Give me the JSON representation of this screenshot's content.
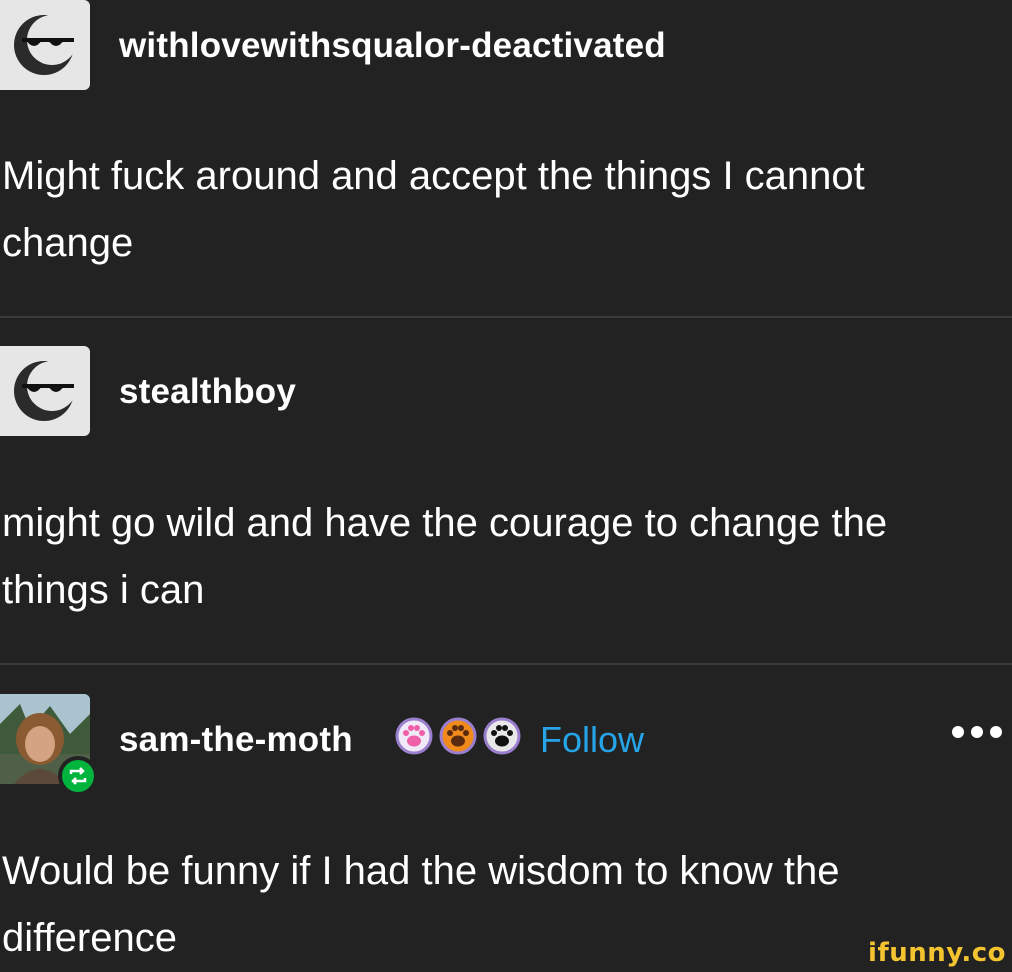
{
  "posts": [
    {
      "username": "withlovewithsqualor-deactivated",
      "avatar_icon": "sunglasses-moon-icon",
      "text_line1": "Might fuck around and accept the things I cannot",
      "text_line2": "change"
    },
    {
      "username": "stealthboy",
      "avatar_icon": "sunglasses-moon-icon",
      "text_line1": "might go wild and have the courage to change the",
      "text_line2": "things i can"
    },
    {
      "username": "sam-the-moth",
      "avatar_icon": "profile-photo",
      "badges": [
        "pink-paw-icon",
        "orange-paw-icon",
        "black-paw-icon"
      ],
      "follow_label": "Follow",
      "text_line1": "Would be funny if I had the wisdom to know the",
      "text_line2": "difference"
    }
  ],
  "watermark": "ifunny.co",
  "colors": {
    "background": "#222222",
    "text": "#ffffff",
    "follow": "#27a4e8",
    "reblog": "#00b43d",
    "watermark": "#f4c430"
  }
}
